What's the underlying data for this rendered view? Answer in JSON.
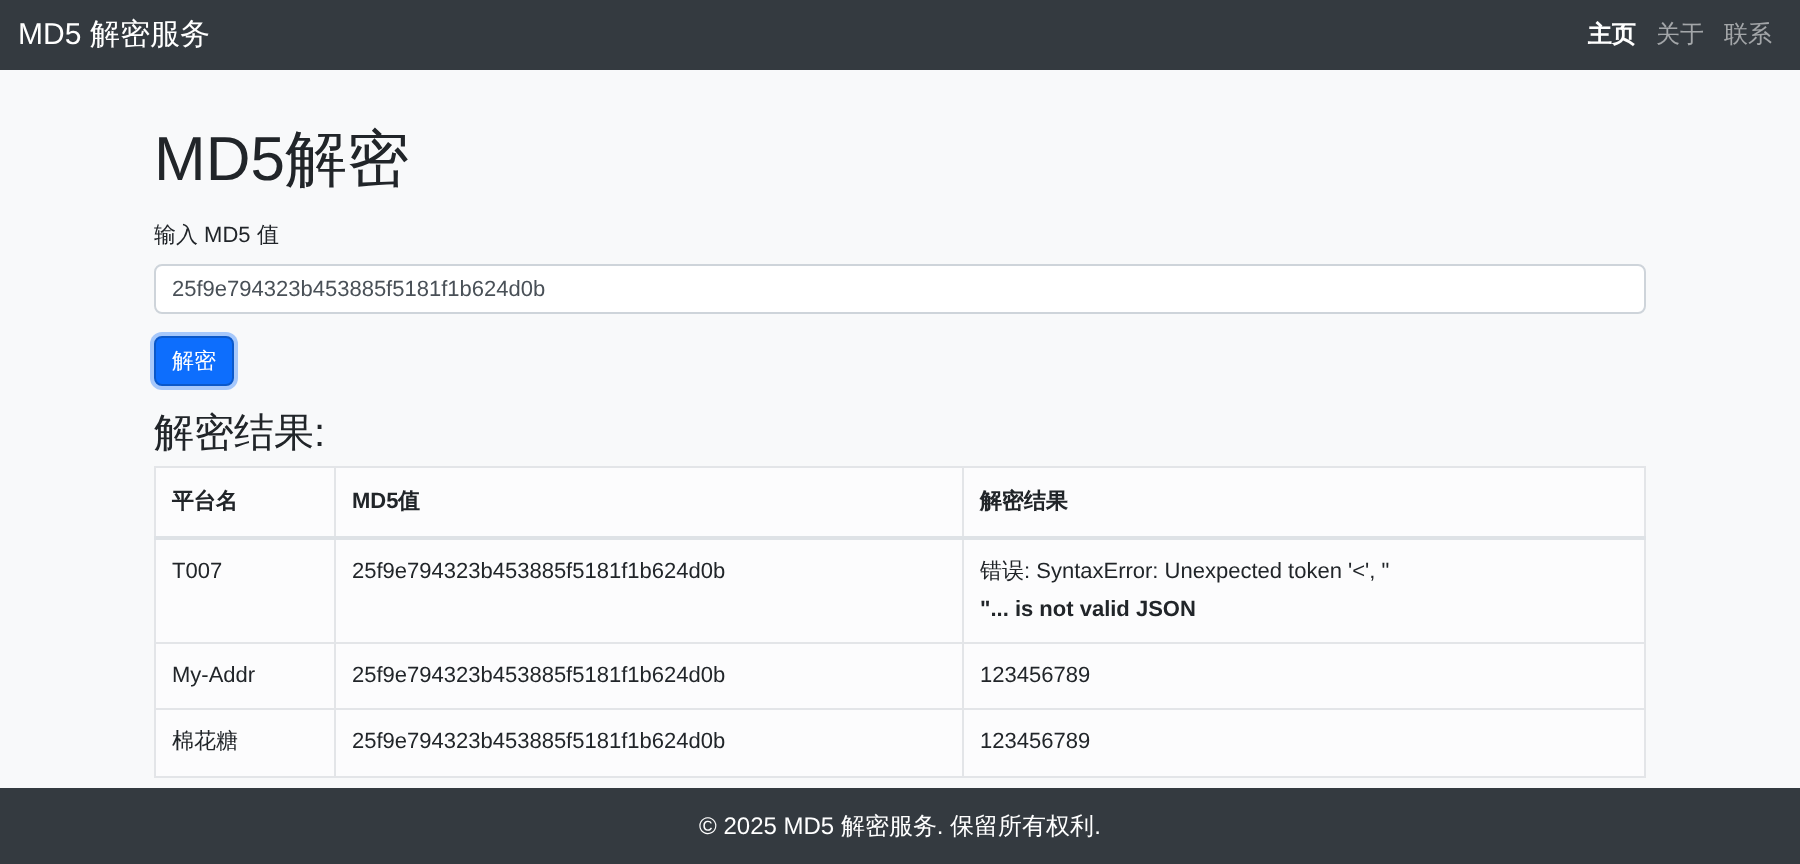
{
  "navbar": {
    "brand": "MD5 解密服务",
    "links": [
      {
        "label": "主页",
        "selected": true
      },
      {
        "label": "关于",
        "selected": false
      },
      {
        "label": "联系",
        "selected": false
      }
    ]
  },
  "title": "MD5解密",
  "form": {
    "label": "输入 MD5 值",
    "value": "25f9e794323b453885f5181f1b624d0b",
    "button": "解密"
  },
  "results": {
    "heading": "解密结果:",
    "columns": [
      "平台名",
      "MD5值",
      "解密结果"
    ],
    "rows": [
      {
        "platform": "T007",
        "md5": "25f9e794323b453885f5181f1b624d0b",
        "result": "错误: SyntaxError: Unexpected token '<', \" **\"... is not valid JSON**"
      },
      {
        "platform": "My-Addr",
        "md5": "25f9e794323b453885f5181f1b624d0b",
        "result": "123456789"
      },
      {
        "platform": "棉花糖",
        "md5": "25f9e794323b453885f5181f1b624d0b",
        "result": "123456789"
      }
    ]
  },
  "footer": "© 2025 MD5 解密服务. 保留所有权利."
}
